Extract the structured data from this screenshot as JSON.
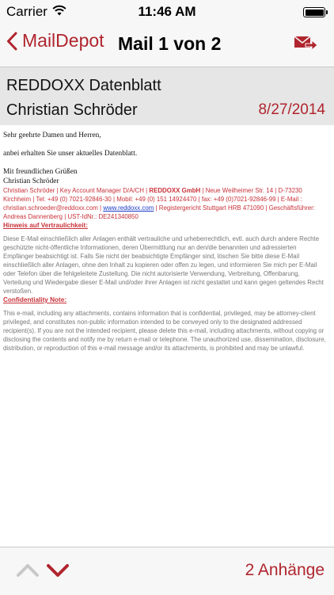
{
  "status_bar": {
    "carrier": "Carrier",
    "time": "11:46 AM"
  },
  "nav": {
    "back_label": "MailDepot",
    "title": "Mail 1 von 2",
    "icons": {
      "back": "chevron-left-icon",
      "reply": "mail-forward-icon"
    }
  },
  "mail": {
    "subject": "REDDOXX Datenblatt",
    "from": "Christian Schröder",
    "date": "8/27/2014"
  },
  "body": {
    "greeting": "Sehr geehrte Damen und Herren,",
    "intro": "anbei erhalten Sie unser aktuelles Datenblatt.",
    "closing": "Mit freundlichen Grüßen",
    "signer": "Christian Schröder",
    "sig": {
      "name": "Christian Schröder",
      "role": "Key Account Manager D/A/CH",
      "company": "REDDOXX GmbH",
      "street": "Neue Weilheimer Str. 14",
      "zip": "D-73230",
      "city": "Kirchheim",
      "tel": "Tel: +49 (0) 7021-92846-30",
      "mobil": "Mobil: +49 (0) 151 14924470",
      "fax": "fax: +49 (0)7021-92846-99",
      "email_label": "E-Mail :",
      "email": "christian.schroeder@reddoxx.com",
      "website": "www.reddoxx.com",
      "register": "Registergericht Stuttgart HRB 471090",
      "gf_label": "Geschäftsführer:",
      "gf": "Andreas Dannenberg",
      "ust": "UST-IdNr.: DE241340850"
    },
    "hinweis_title": "Hinweis auf Vertraulichkeit:",
    "hinweis_text": "Diese E-Mail einschließlich aller Anlagen enthält vertrauliche und urheberrechtlich, evtl. auch durch andere Rechte geschützte nicht-öffentliche Informationen, deren Übermittlung nur an den/die benannten und adressierten Empfänger beabsichtigt ist. Falls Sie nicht der beabsichtigte Empfänger sind, löschen Sie bitte diese E-Mail einschließlich aller Anlagen, ohne den Inhalt zu kopieren oder offen zu legen, und informieren Sie mich per E-Mail oder Telefon über die fehlgeleitete Zustellung. Die nicht autorisierte Verwendung, Verbreitung, Offenbarung, Verteilung und Wiedergabe dieser E-Mail und/oder ihrer Anlagen ist nicht gestattet und kann gegen geltendes Recht verstoßen.",
    "conf_title": "Confidentiality Note:",
    "conf_text": "This e-mail, including any attachments, contains information that is confidential, privileged, may be attorney-client privileged, and constitutes non-public information intended to be conveyed only to the designated addressed recipient(s). If you are not the intended recipient, please delete this e-mail, including attachments, without copying or disclosing the contents and notify me by return e-mail or telephone. The unauthorized use, dissemination, disclosure, distribution, or reproduction of this e-mail message and/or its attachments, is prohibited and may be unlawful."
  },
  "toolbar": {
    "attachments_label": "2 Anhänge",
    "icons": {
      "prev": "chevron-up-icon",
      "next": "chevron-down-icon"
    }
  },
  "colors": {
    "accent": "#b0252e",
    "header_bg": "#e6e6e6",
    "bar_bg": "#f7f7f7"
  }
}
